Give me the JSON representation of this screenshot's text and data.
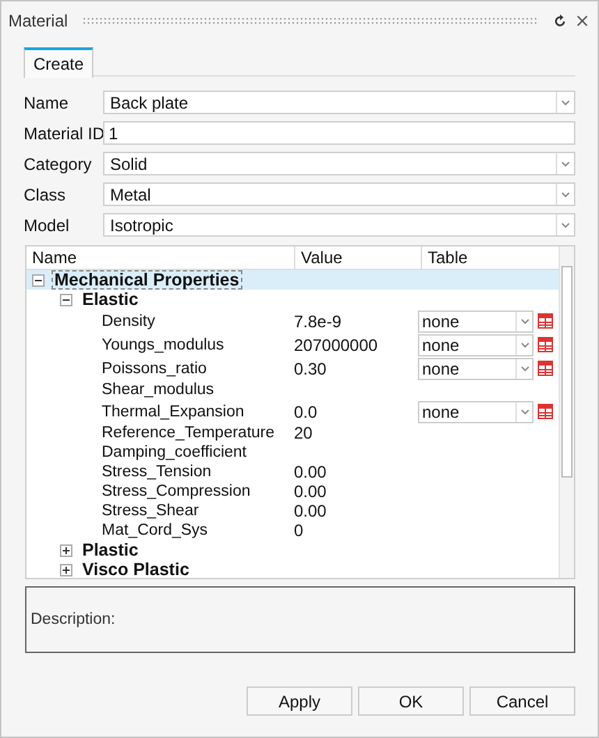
{
  "window": {
    "title": "Material"
  },
  "tabs": [
    {
      "label": "Create",
      "selected": true
    }
  ],
  "form": [
    {
      "label": "Name",
      "kind": "dropdown",
      "value": "Back plate"
    },
    {
      "label": "Material ID",
      "kind": "text",
      "value": "1"
    },
    {
      "label": "Category",
      "kind": "dropdown",
      "value": "Solid"
    },
    {
      "label": "Class",
      "kind": "dropdown",
      "value": "Metal"
    },
    {
      "label": "Model",
      "kind": "dropdown",
      "value": "Isotropic"
    }
  ],
  "tree": {
    "columns": [
      "Name",
      "Value",
      "Table"
    ],
    "items": [
      {
        "label": "Mechanical Properties",
        "kind": "group",
        "expanded": true,
        "selected": true,
        "children": [
          {
            "label": "Elastic",
            "kind": "group",
            "expanded": true,
            "selected": false,
            "children": [
              {
                "label": "Density",
                "kind": "property",
                "value": "7.8e-9",
                "table": "none",
                "selected": false
              },
              {
                "label": "Youngs_modulus",
                "kind": "property",
                "value": "207000000",
                "table": "none",
                "selected": false
              },
              {
                "label": "Poissons_ratio",
                "kind": "property",
                "value": "0.30",
                "table": "none",
                "selected": false
              },
              {
                "label": "Shear_modulus",
                "kind": "property",
                "selected": false
              },
              {
                "label": "Thermal_Expansion",
                "kind": "property",
                "value": "0.0",
                "table": "none",
                "selected": false
              },
              {
                "label": "Reference_Temperature",
                "kind": "property",
                "value": "20",
                "selected": false
              },
              {
                "label": "Damping_coefficient",
                "kind": "property",
                "selected": false
              },
              {
                "label": "Stress_Tension",
                "kind": "property",
                "value": "0.00",
                "selected": false
              },
              {
                "label": "Stress_Compression",
                "kind": "property",
                "value": "0.00",
                "selected": false
              },
              {
                "label": "Stress_Shear",
                "kind": "property",
                "value": "0.00",
                "selected": false
              },
              {
                "label": "Mat_Cord_Sys",
                "kind": "property",
                "value": "0",
                "selected": false
              }
            ]
          },
          {
            "label": "Plastic",
            "kind": "group",
            "expanded": false,
            "selected": false
          },
          {
            "label": "Visco Plastic",
            "kind": "group",
            "expanded": false,
            "selected": false
          }
        ]
      }
    ]
  },
  "description": {
    "label": "Description:"
  },
  "buttons": [
    "Apply",
    "OK",
    "Cancel"
  ]
}
